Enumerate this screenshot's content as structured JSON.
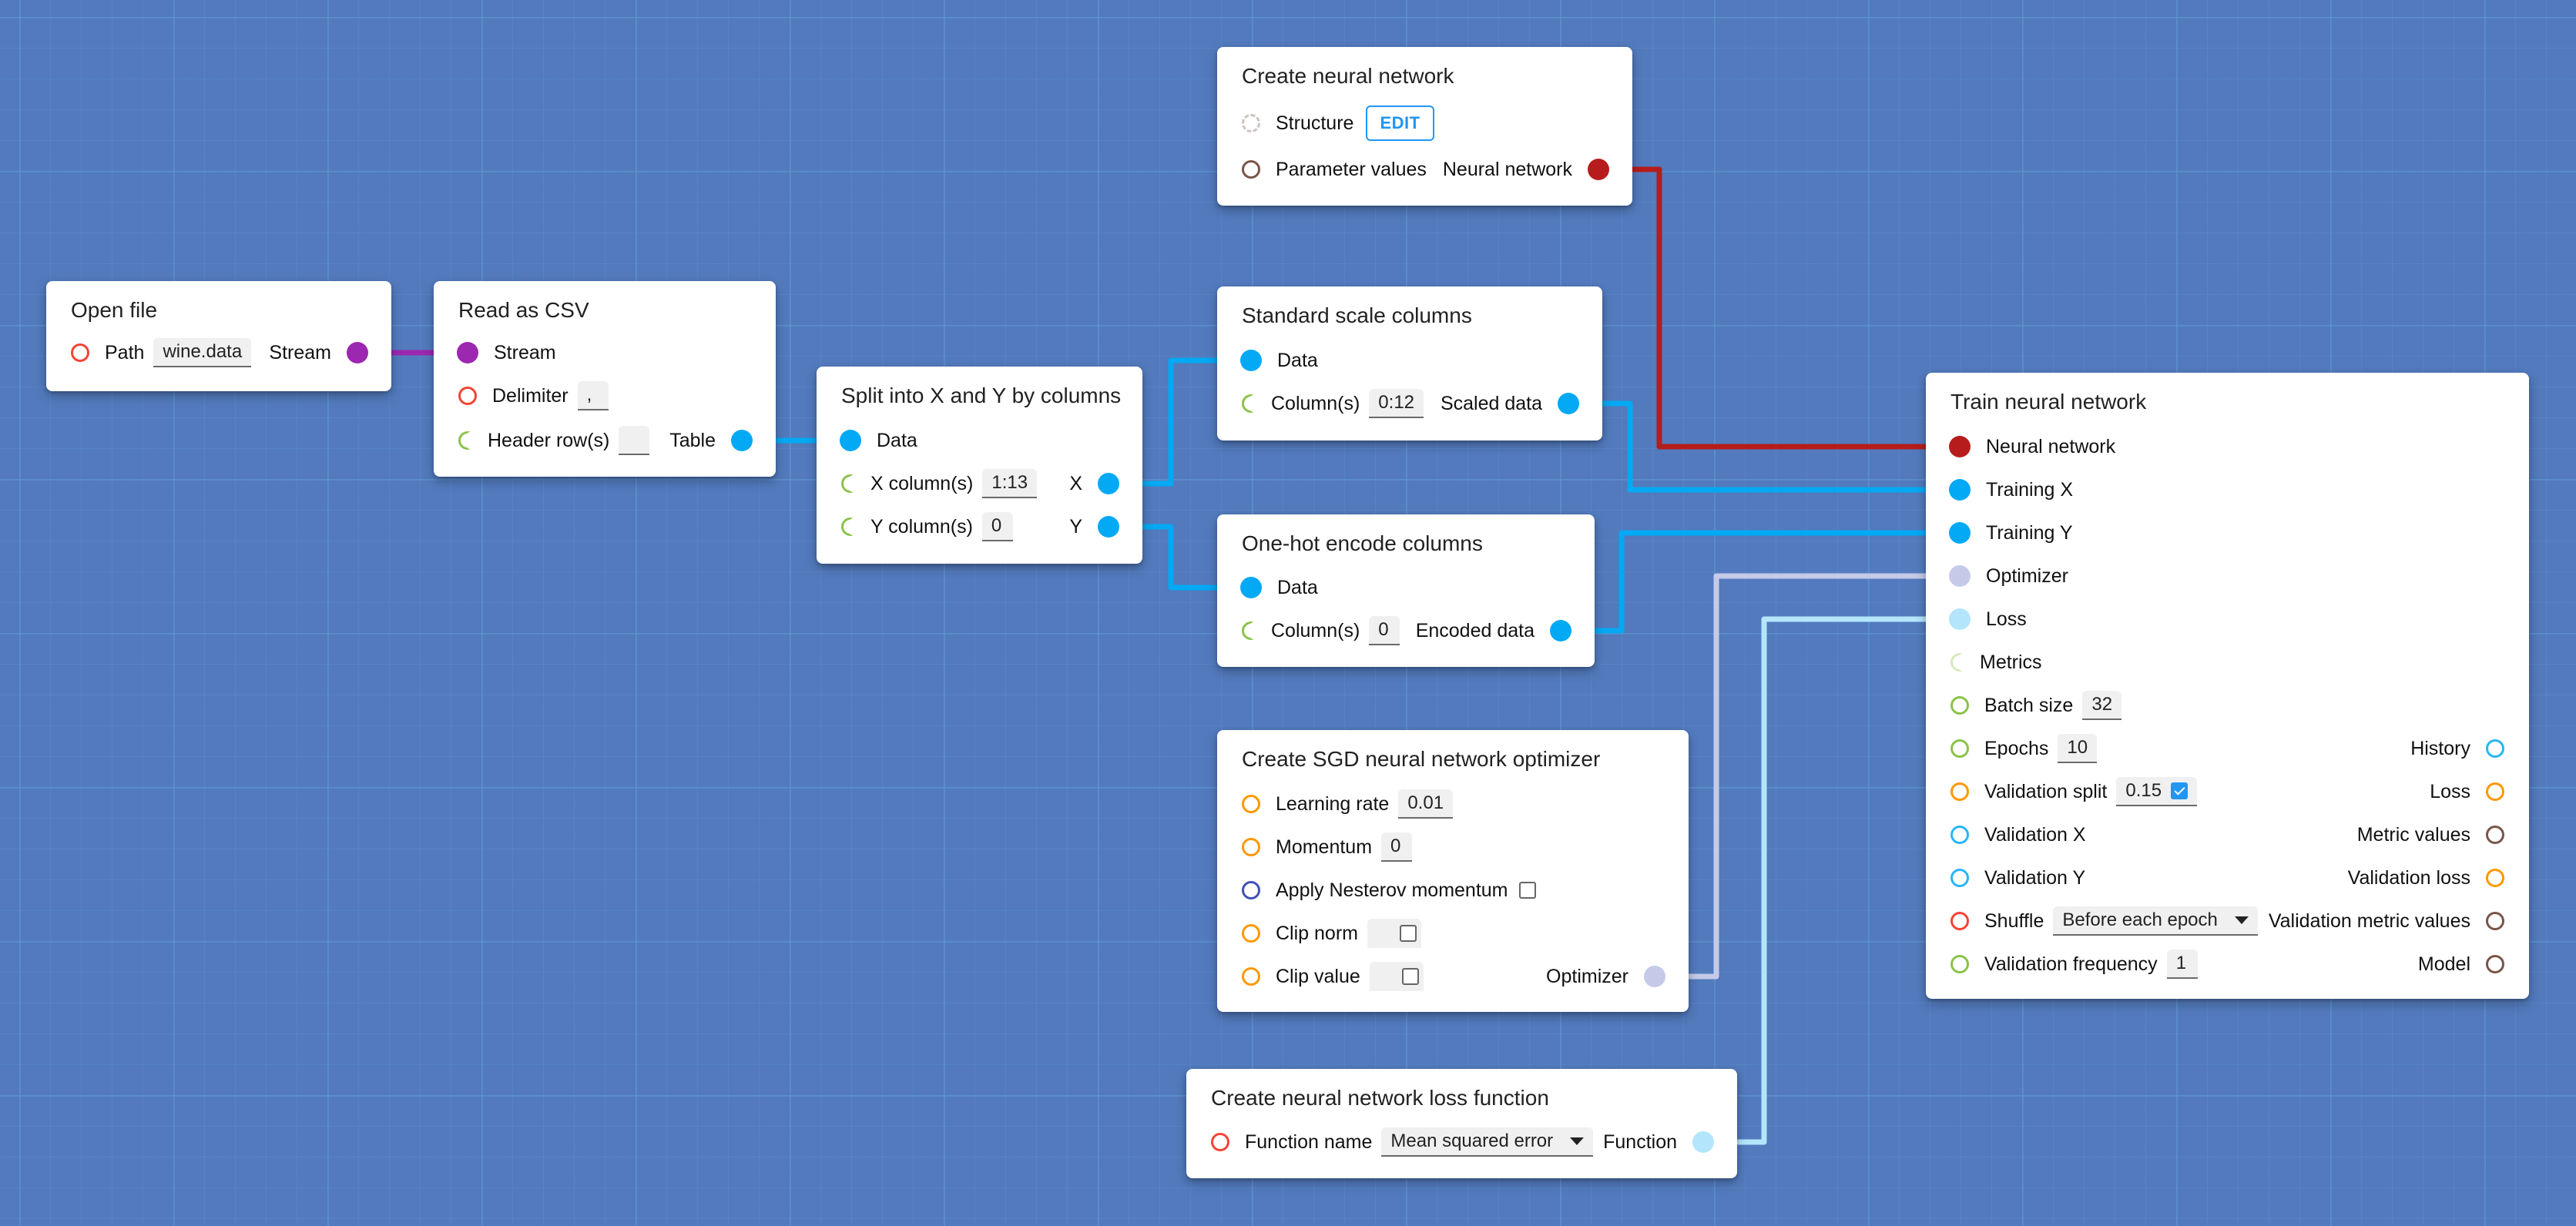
{
  "colors": {
    "background": "#527abd",
    "stream": "#9c27b0",
    "data": "#03a9f4",
    "neural_network": "#b71c1c",
    "optimizer": "#c5cae9",
    "loss": "#b3e5fc",
    "required_red": "#f44336",
    "optional_green": "#8bc34a",
    "orange": "#ff9800",
    "indigo": "#3f51b5",
    "brown": "#795548",
    "light_blue": "#29b6f6",
    "accent": "#2196f3"
  },
  "nodes": {
    "open_file": {
      "title": "Open file",
      "path_label": "Path",
      "path_value": "wine.data",
      "stream_label": "Stream"
    },
    "read_csv": {
      "title": "Read as CSV",
      "stream_label": "Stream",
      "delimiter_label": "Delimiter",
      "delimiter_value": ",",
      "header_label": "Header row(s)",
      "header_value": "",
      "table_label": "Table"
    },
    "split": {
      "title": "Split into X and Y by columns",
      "data_label": "Data",
      "x_columns_label": "X column(s)",
      "x_columns_value": "1:13",
      "x_label": "X",
      "y_columns_label": "Y column(s)",
      "y_columns_value": "0",
      "y_label": "Y"
    },
    "create_nn": {
      "title": "Create neural network",
      "structure_label": "Structure",
      "edit_label": "EDIT",
      "param_label": "Parameter values",
      "output_label": "Neural network"
    },
    "standard_scale": {
      "title": "Standard scale columns",
      "data_label": "Data",
      "columns_label": "Column(s)",
      "columns_value": "0:12",
      "output_label": "Scaled data"
    },
    "one_hot": {
      "title": "One-hot encode columns",
      "data_label": "Data",
      "columns_label": "Column(s)",
      "columns_value": "0",
      "output_label": "Encoded data"
    },
    "sgd": {
      "title": "Create SGD neural network optimizer",
      "learning_rate_label": "Learning rate",
      "learning_rate_value": "0.01",
      "momentum_label": "Momentum",
      "momentum_value": "0",
      "nesterov_label": "Apply Nesterov momentum",
      "nesterov_checked": false,
      "clip_norm_label": "Clip norm",
      "clip_norm_checked": false,
      "clip_value_label": "Clip value",
      "clip_value_checked": false,
      "output_label": "Optimizer"
    },
    "loss_fn": {
      "title": "Create neural network loss function",
      "function_name_label": "Function name",
      "function_name_value": "Mean squared error",
      "output_label": "Function"
    },
    "train": {
      "title": "Train neural network",
      "inputs": {
        "neural_network": "Neural network",
        "training_x": "Training X",
        "training_y": "Training Y",
        "optimizer": "Optimizer",
        "loss": "Loss",
        "metrics": "Metrics",
        "batch_size": "Batch size",
        "epochs": "Epochs",
        "validation_split": "Validation split",
        "validation_x": "Validation X",
        "validation_y": "Validation Y",
        "shuffle": "Shuffle",
        "validation_frequency": "Validation frequency"
      },
      "values": {
        "batch_size": "32",
        "epochs": "10",
        "validation_split": "0.15",
        "validation_split_enabled": true,
        "shuffle": "Before each epoch",
        "validation_frequency": "1"
      },
      "outputs": {
        "history": "History",
        "loss": "Loss",
        "metric_values": "Metric values",
        "validation_loss": "Validation loss",
        "validation_metric_values": "Validation metric values",
        "model": "Model"
      }
    }
  },
  "connections": [
    {
      "from": "open_file.Stream",
      "to": "read_csv.Stream",
      "type": "stream"
    },
    {
      "from": "read_csv.Table",
      "to": "split.Data",
      "type": "data"
    },
    {
      "from": "split.X",
      "to": "standard_scale.Data",
      "type": "data"
    },
    {
      "from": "split.Y",
      "to": "one_hot.Data",
      "type": "data"
    },
    {
      "from": "create_nn.Neural network",
      "to": "train.Neural network",
      "type": "neural_network"
    },
    {
      "from": "standard_scale.Scaled data",
      "to": "train.Training X",
      "type": "data"
    },
    {
      "from": "one_hot.Encoded data",
      "to": "train.Training Y",
      "type": "data"
    },
    {
      "from": "sgd.Optimizer",
      "to": "train.Optimizer",
      "type": "optimizer"
    },
    {
      "from": "loss_fn.Function",
      "to": "train.Loss",
      "type": "loss"
    }
  ]
}
